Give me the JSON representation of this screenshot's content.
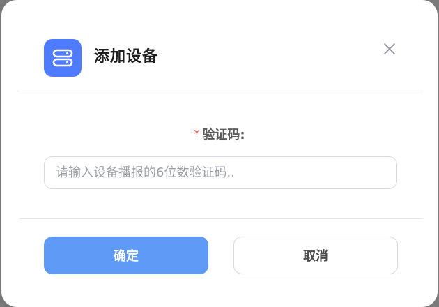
{
  "dialog": {
    "title": "添加设备",
    "icon": "server-icon",
    "close_icon": "close-icon"
  },
  "form": {
    "label": "验证码:",
    "required_mark": "*",
    "input": {
      "value": "",
      "placeholder": "请输入设备播报的6位数验证码.."
    }
  },
  "actions": {
    "confirm_label": "确定",
    "cancel_label": "取消"
  },
  "colors": {
    "accent": "#4f7cff",
    "confirm_button": "#5f9bf6",
    "required": "#e54848"
  }
}
